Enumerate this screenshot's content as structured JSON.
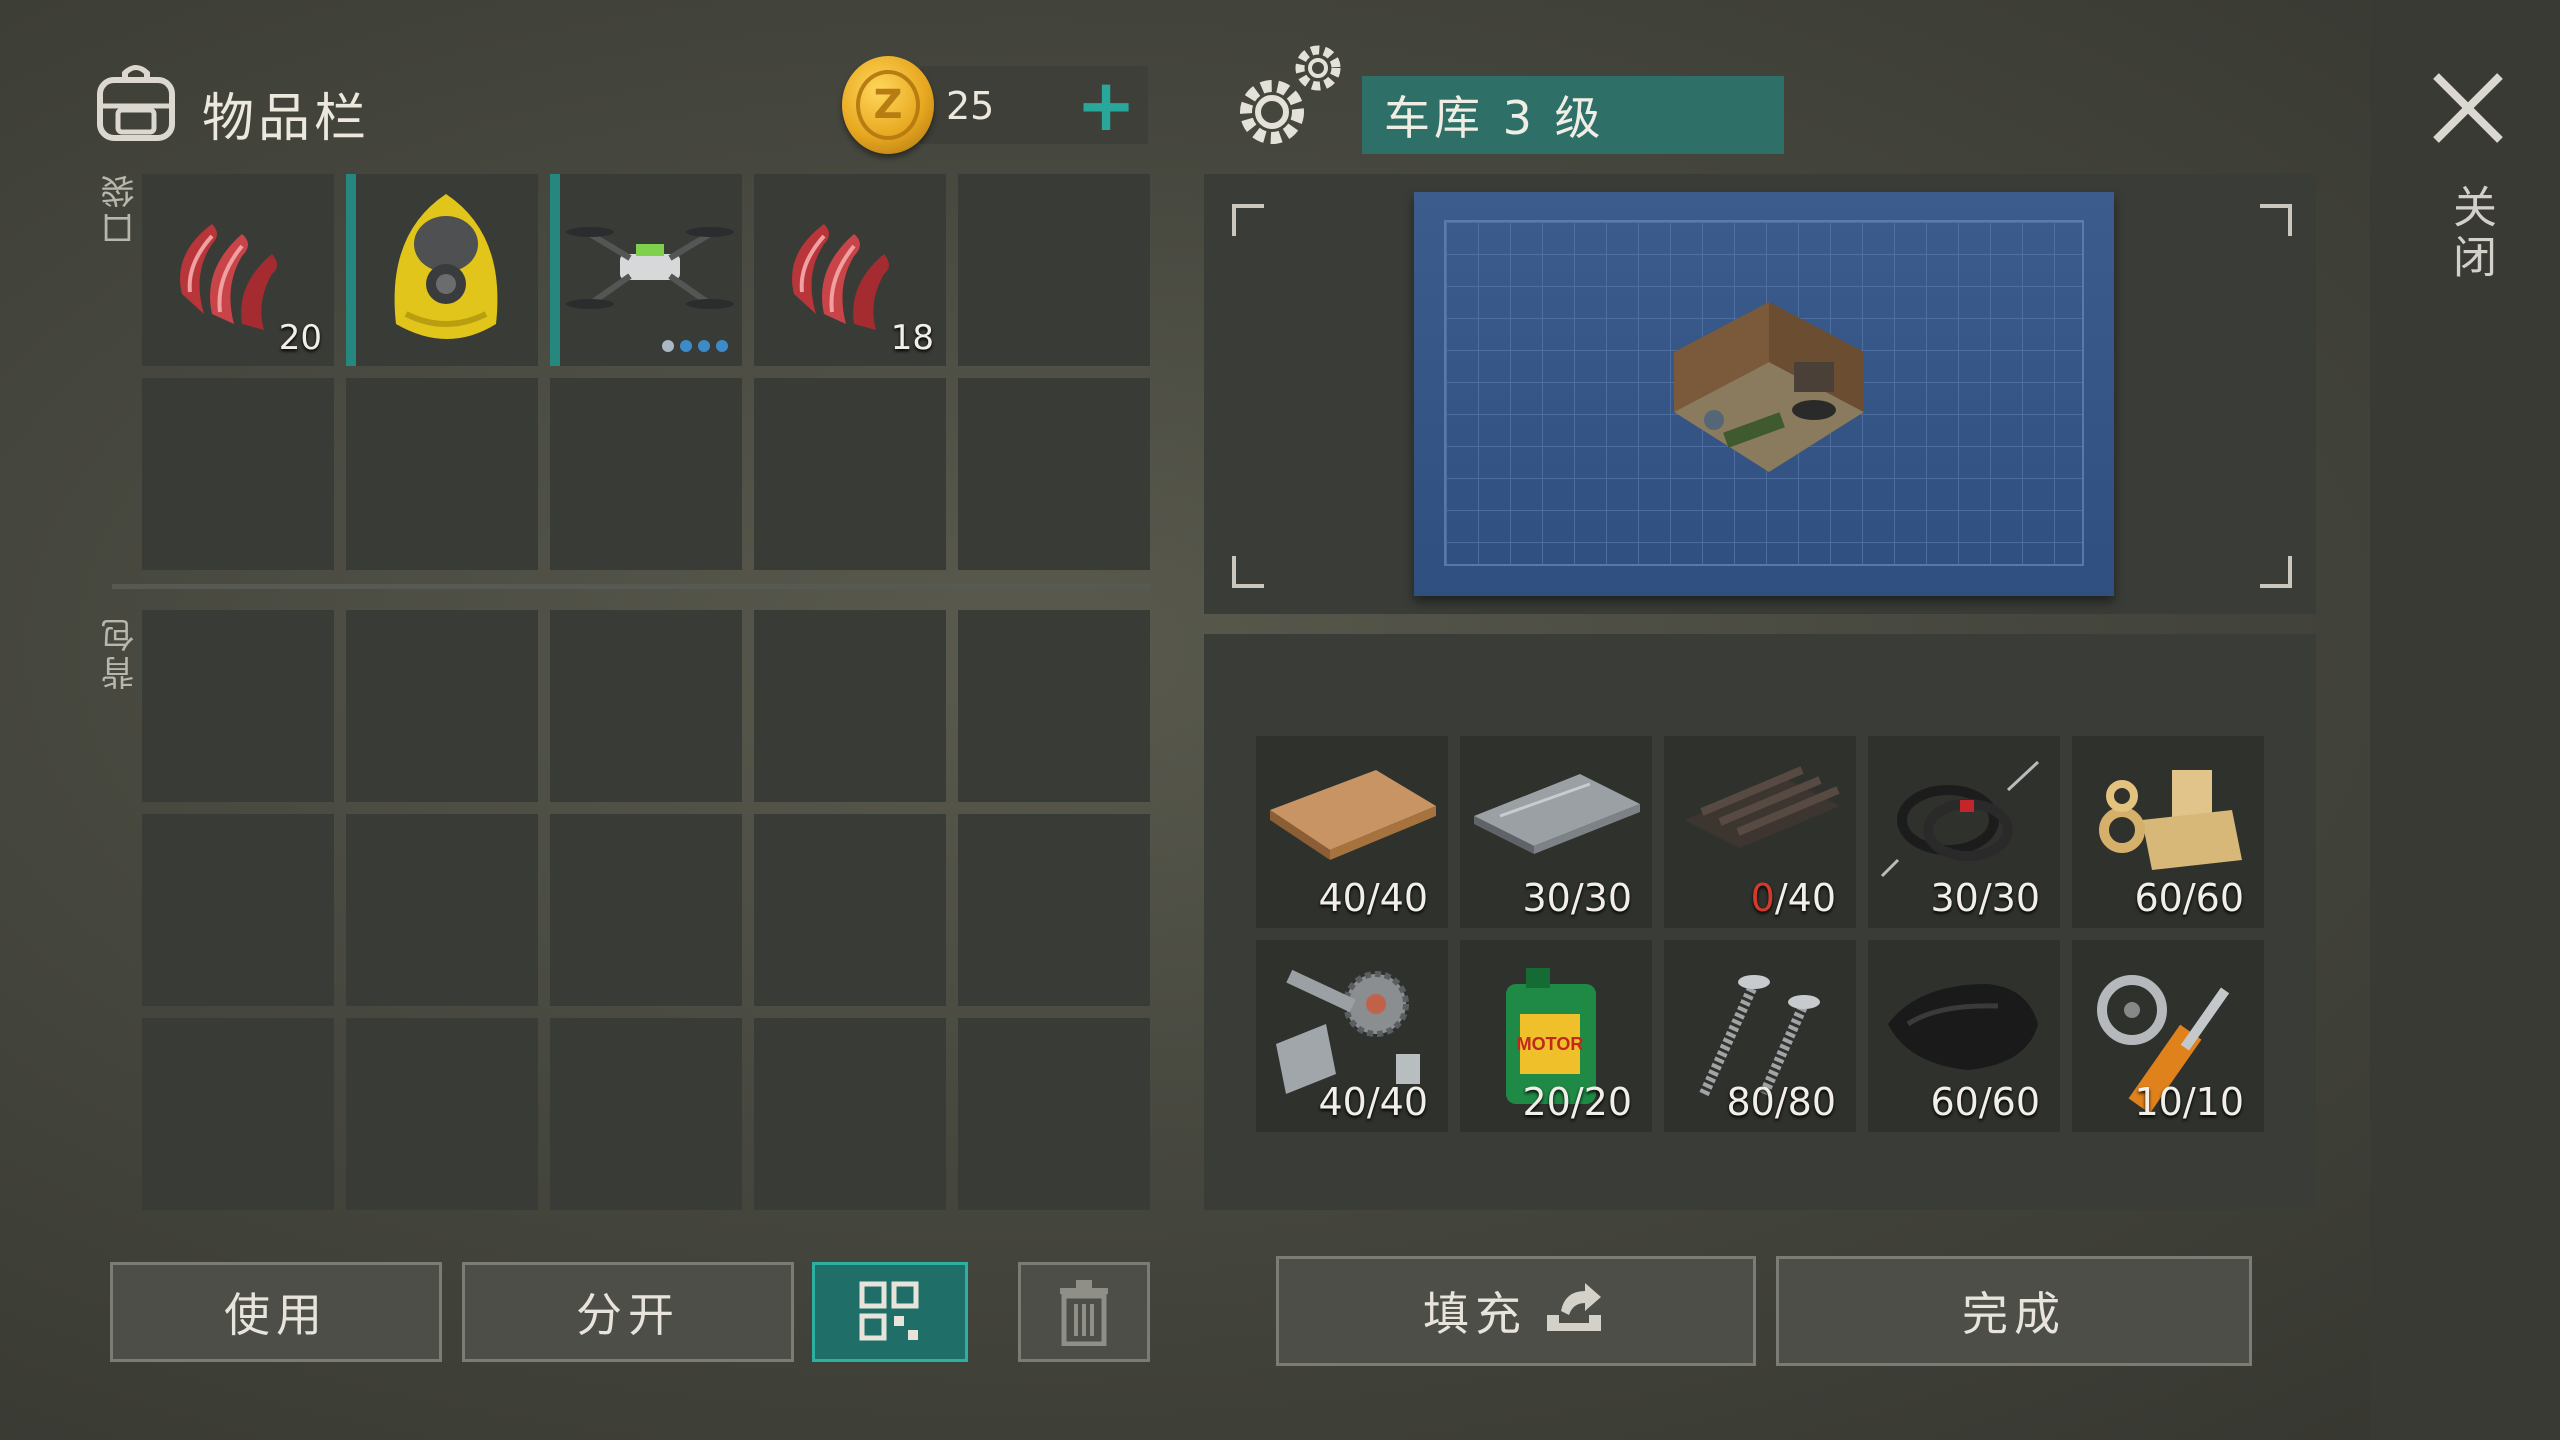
{
  "header": {
    "title": "物品栏",
    "currency": {
      "icon": "z-coin-icon",
      "value": "25"
    },
    "add_icon": "plus-icon"
  },
  "sections": {
    "pockets": "口袋",
    "backpack": "背包"
  },
  "pockets": {
    "slots": [
      {
        "name": "raw-meat-icon",
        "quantity": "20"
      },
      {
        "name": "hazmat-suit-icon",
        "quantity": ""
      },
      {
        "name": "drone-icon",
        "quantity": "",
        "charge_dots": 4,
        "charge_filled": 3
      },
      {
        "name": "raw-meat-icon",
        "quantity": "18"
      }
    ]
  },
  "buttons": {
    "use": "使用",
    "split": "分开",
    "sort_icon": "grid-sort-icon",
    "trash_icon": "trash-icon"
  },
  "building": {
    "title": "车库 3 级",
    "icon": "gears-icon"
  },
  "close": {
    "label": "关闭",
    "icon": "close-x-icon"
  },
  "materials": [
    {
      "name": "plank-icon",
      "have": "40",
      "need": "40"
    },
    {
      "name": "metal-plate-icon",
      "have": "30",
      "need": "30"
    },
    {
      "name": "slate-sheet-icon",
      "have": "0",
      "need": "40"
    },
    {
      "name": "wires-icon",
      "have": "30",
      "need": "30"
    },
    {
      "name": "wood-parts-icon",
      "have": "60",
      "need": "60"
    },
    {
      "name": "metal-parts-icon",
      "have": "40",
      "need": "40"
    },
    {
      "name": "motor-oil-icon",
      "have": "20",
      "need": "20"
    },
    {
      "name": "screws-icon",
      "have": "80",
      "need": "80"
    },
    {
      "name": "leather-icon",
      "have": "60",
      "need": "60"
    },
    {
      "name": "hydraulics-icon",
      "have": "10",
      "need": "10"
    }
  ],
  "actions": {
    "fill": "填充",
    "fill_icon": "fill-arrow-icon",
    "done": "完成"
  },
  "colors": {
    "accent": "#2aa79b",
    "missing": "#d23a2e"
  }
}
